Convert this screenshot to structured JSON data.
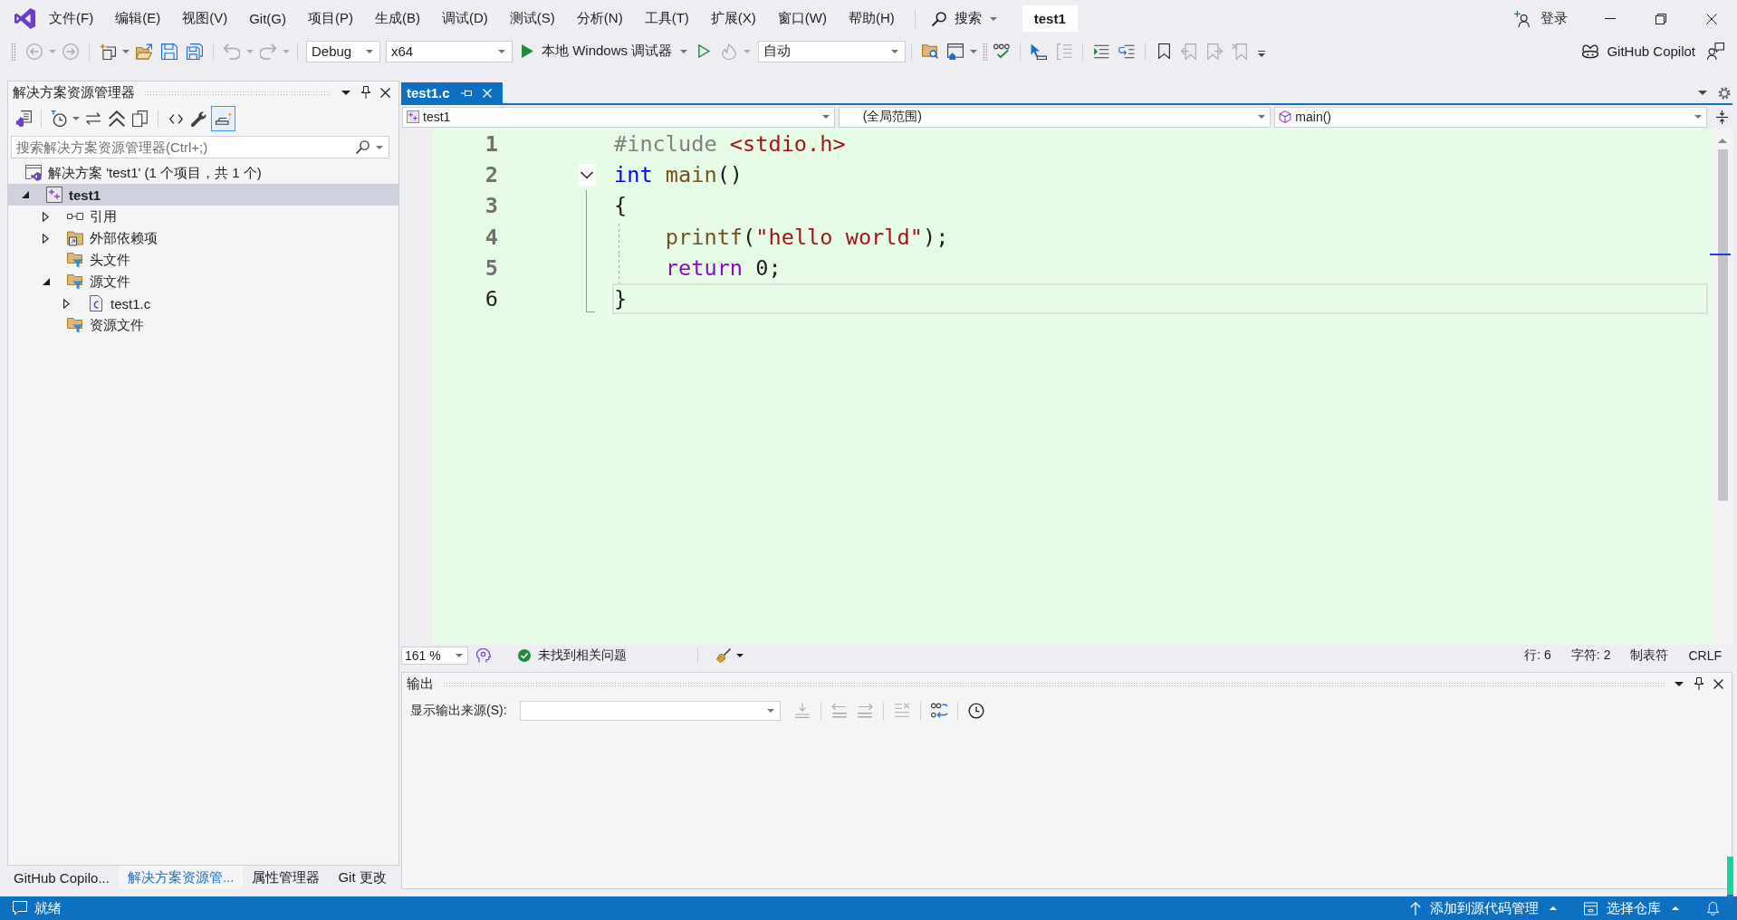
{
  "menu_bar": {
    "items": [
      "文件(F)",
      "编辑(E)",
      "视图(V)",
      "Git(G)",
      "项目(P)",
      "生成(B)",
      "调试(D)",
      "测试(S)",
      "分析(N)",
      "工具(T)",
      "扩展(X)",
      "窗口(W)",
      "帮助(H)"
    ],
    "search_label": "搜索",
    "solution_name": "test1",
    "sign_in": "登录"
  },
  "toolbar": {
    "back": {
      "disabled": true
    },
    "forward": {
      "disabled": true
    },
    "undo": {
      "disabled": true
    },
    "redo": {
      "disabled": true
    },
    "configuration": "Debug",
    "platform": "x64",
    "start_label": "本地 Windows 调试器",
    "hot_reload": {
      "disabled": true
    },
    "startup_item": "自动",
    "uncomment": {
      "disabled": true
    },
    "bookmark_prev": {
      "disabled": true
    },
    "bookmark_next": {
      "disabled": true
    },
    "bookmark_clear": {
      "disabled": true
    },
    "copilot_label": "GitHub Copilot"
  },
  "solution_explorer": {
    "title": "解决方案资源管理器",
    "preview_toggle": {
      "on": true
    },
    "search_placeholder": "搜索解决方案资源管理器(Ctrl+;)",
    "tree": [
      {
        "kind": "solution",
        "label": "解决方案 'test1' (1 个项目，共 1 个)",
        "selected": false,
        "children": [
          {
            "kind": "project",
            "label": "test1",
            "selected": true,
            "expanded": true,
            "children": [
              {
                "kind": "references",
                "label": "引用",
                "selected": false,
                "expanded": false
              },
              {
                "kind": "external",
                "label": "外部依赖项",
                "selected": false,
                "expanded": false
              },
              {
                "kind": "filter",
                "label": "头文件",
                "selected": false
              },
              {
                "kind": "filter",
                "label": "源文件",
                "selected": false,
                "expanded": true,
                "children": [
                  {
                    "kind": "file",
                    "label": "test1.c",
                    "selected": false,
                    "expanded": false
                  }
                ]
              },
              {
                "kind": "filter",
                "label": "资源文件",
                "selected": false
              }
            ]
          }
        ]
      }
    ],
    "bottom_tabs": [
      {
        "label": "GitHub Copilo...",
        "selected": false
      },
      {
        "label": "解决方案资源管...",
        "selected": true
      },
      {
        "label": "属性管理器",
        "selected": false
      },
      {
        "label": "Git 更改",
        "selected": false
      }
    ]
  },
  "editor": {
    "tabs": [
      {
        "label": "test1.c",
        "selected": true
      }
    ],
    "nav_bar": {
      "project": "test1",
      "scope": "(全局范围)",
      "member": "main()"
    },
    "lines": [
      {
        "number": "1",
        "current": false,
        "tokens": [
          {
            "kind": "preprocessor",
            "text": "#include "
          },
          {
            "kind": "string",
            "text": "<stdio.h>"
          }
        ]
      },
      {
        "number": "2",
        "current": false,
        "expanded": true,
        "tokens": [
          {
            "kind": "keyword",
            "text": "int "
          },
          {
            "kind": "function",
            "text": "main"
          },
          {
            "kind": "plain",
            "text": "()"
          }
        ],
        "children": [
          {
            "number": "3",
            "current": false,
            "tokens": [
              {
                "kind": "plain",
                "text": "{"
              }
            ]
          },
          {
            "number": "4",
            "current": false,
            "tokens": [
              {
                "kind": "function",
                "text": "    printf"
              },
              {
                "kind": "plain",
                "text": "("
              },
              {
                "kind": "string",
                "text": "\"hello world\""
              },
              {
                "kind": "plain",
                "text": ");"
              }
            ]
          },
          {
            "number": "5",
            "current": false,
            "tokens": [
              {
                "kind": "control",
                "text": "    return "
              },
              {
                "kind": "number",
                "text": "0"
              },
              {
                "kind": "plain",
                "text": ";"
              }
            ]
          },
          {
            "number": "6",
            "current": true,
            "tokens": [
              {
                "kind": "plain",
                "text": "}"
              }
            ]
          }
        ]
      }
    ],
    "zoom": "161 %",
    "issues": "未找到相关问题",
    "line_position": "行: 6",
    "char_position": "字符: 2",
    "indentation": "制表符",
    "line_ending": "CRLF"
  },
  "output": {
    "title": "输出",
    "source_label": "显示输出来源(S):",
    "go_to_source": {
      "disabled": true
    },
    "prev_message": {
      "disabled": true
    },
    "next_message": {
      "disabled": true
    },
    "clear_all": {
      "disabled": true
    }
  },
  "status_bar": {
    "message": "就绪",
    "source_control": "添加到源代码管理",
    "repository": "选择仓库"
  }
}
